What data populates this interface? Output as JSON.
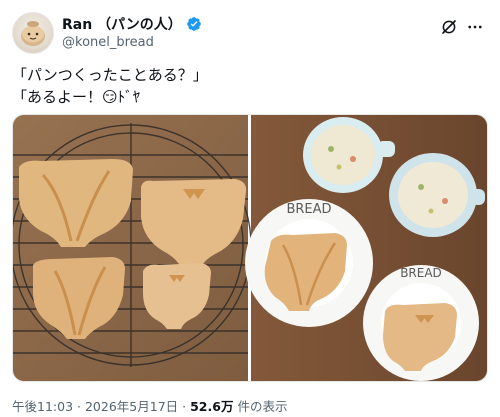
{
  "author": {
    "display_name": "Ran （パンの人）",
    "handle": "@konel_bread",
    "verified": true,
    "avatar_icon": "bread-character-avatar"
  },
  "header_actions": {
    "grok_icon": "grok-icon",
    "more_icon": "more-options-icon"
  },
  "tweet": {
    "lines": [
      "「パンつくったことある？」",
      "「あるよー！😏ﾄﾞﾔ"
    ]
  },
  "media": {
    "images": [
      {
        "icon": "bread-on-cooling-rack-photo"
      },
      {
        "icon": "bread-with-soup-on-plates-photo",
        "plate_text": "BREAD"
      }
    ]
  },
  "footer": {
    "time": "午後11:03",
    "separator": "·",
    "date": "2026年5月17日",
    "views_count": "52.6万",
    "views_label": "件の表示"
  },
  "colors": {
    "verified_blue": "#1d9bf0",
    "text_primary": "#0f1419",
    "text_secondary": "#536471"
  }
}
